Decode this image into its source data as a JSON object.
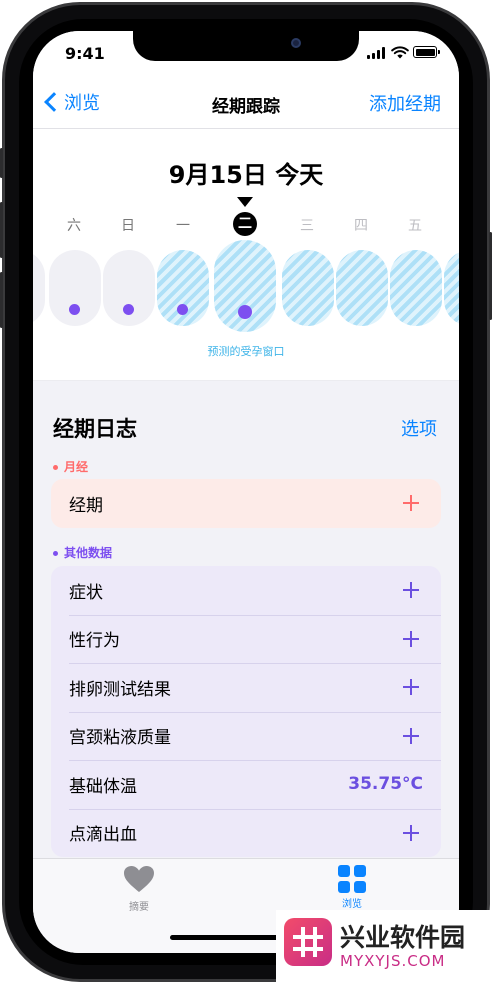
{
  "status_bar": {
    "time": "9:41"
  },
  "nav": {
    "back_label": "浏览",
    "title": "经期跟踪",
    "action_label": "添加经期"
  },
  "calendar": {
    "date_label": "9月15日 今天",
    "weekdays": [
      "六",
      "日",
      "一",
      "二",
      "三",
      "四",
      "五"
    ],
    "fertile_window_label": "预测的受孕窗口"
  },
  "cycle_log": {
    "title": "经期日志",
    "options_label": "选项",
    "period_section": {
      "label": "月经",
      "rows": [
        {
          "label": "经期"
        }
      ]
    },
    "other_section": {
      "label": "其他数据",
      "rows": [
        {
          "label": "症状"
        },
        {
          "label": "性行为"
        },
        {
          "label": "排卵测试结果"
        },
        {
          "label": "宫颈粘液质量"
        },
        {
          "label": "基础体温",
          "value": "35.75°C"
        },
        {
          "label": "点滴出血"
        }
      ]
    }
  },
  "tab_bar": {
    "tabs": [
      {
        "label": "摘要",
        "icon": "heart-icon"
      },
      {
        "label": "浏览",
        "icon": "grid-icon",
        "selected": true
      }
    ]
  },
  "colors": {
    "accent": "#0a84ff",
    "period": "#ff6b6b",
    "other_data": "#7d4ff0",
    "fertile": "#3fb4e8",
    "temperature": "#6b4fe0"
  },
  "watermark": {
    "title": "兴业软件园",
    "subtitle": "MYXYJS.COM"
  }
}
